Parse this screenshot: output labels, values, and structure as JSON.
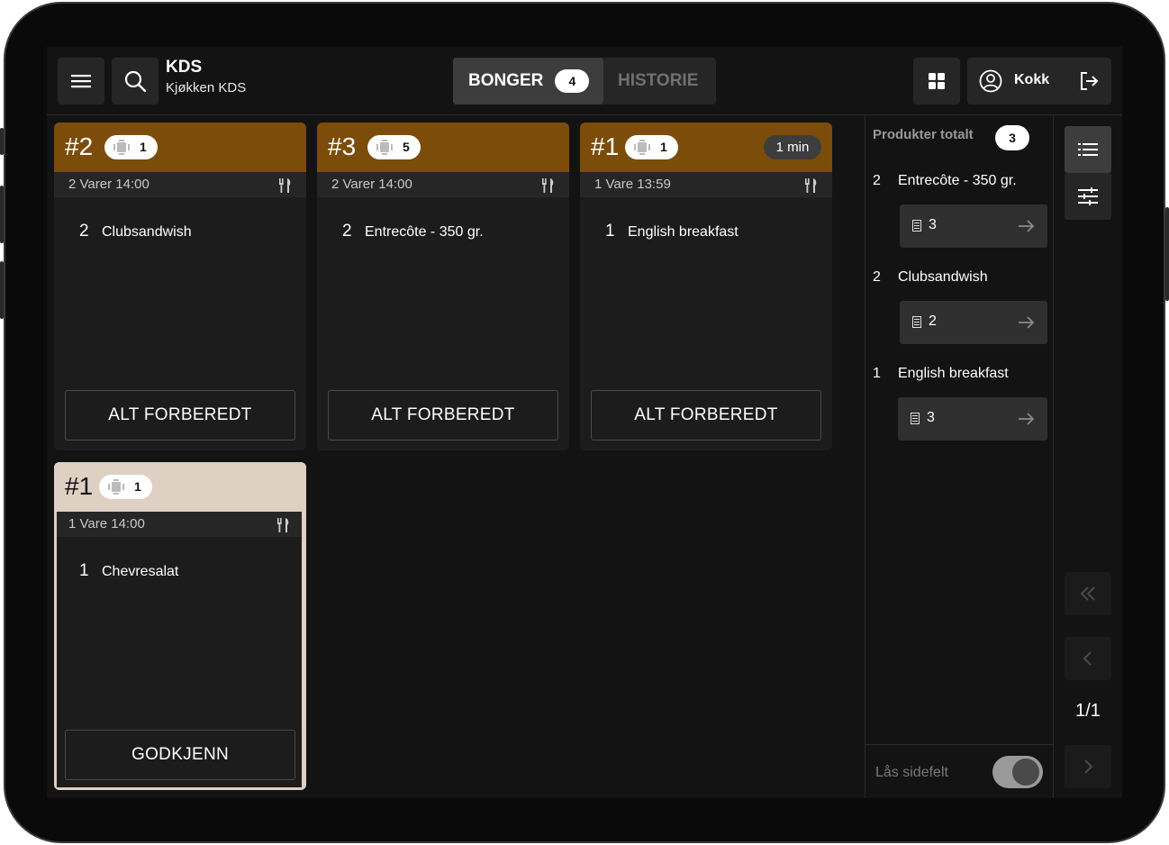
{
  "app": {
    "title": "KDS",
    "subtitle": "Kjøkken KDS"
  },
  "toolbar": {
    "menu_icon": "menu-icon",
    "search_icon": "search-icon",
    "grid_icon": "grid-icon",
    "user_icon": "user-circle-icon",
    "logout_icon": "logout-icon"
  },
  "tabs": [
    {
      "label": "BONGER",
      "count": "4",
      "active": true
    },
    {
      "label": "HISTORIE",
      "active": false
    }
  ],
  "user": {
    "name": "Kokk"
  },
  "orders": [
    {
      "number": "#2",
      "guests": "1",
      "info": "2 Varer  14:00",
      "items": [
        {
          "qty": "2",
          "name": "Clubsandwish"
        }
      ],
      "action": "ALT FORBEREDT"
    },
    {
      "number": "#3",
      "guests": "5",
      "info": "2 Varer  14:00",
      "items": [
        {
          "qty": "2",
          "name": "Entrecôte - 350 gr."
        }
      ],
      "action": "ALT FORBEREDT"
    },
    {
      "number": "#1",
      "guests": "1",
      "timer": "1 min",
      "info": "1 Vare  13:59",
      "items": [
        {
          "qty": "1",
          "name": "English breakfast"
        }
      ],
      "action": "ALT FORBEREDT"
    },
    {
      "number": "#1",
      "guests": "1",
      "info": "1 Vare  14:00",
      "items": [
        {
          "qty": "1",
          "name": "Chevresalat"
        }
      ],
      "action": "GODKJENN"
    }
  ],
  "products_panel": {
    "title": "Produkter totalt",
    "count": "3",
    "items": [
      {
        "qty": "2",
        "name": "Entrecôte - 350 gr.",
        "orders": "3"
      },
      {
        "qty": "2",
        "name": "Clubsandwish",
        "orders": "2"
      },
      {
        "qty": "1",
        "name": "English breakfast",
        "orders": "3"
      }
    ],
    "lock_label": "Lås sidefelt",
    "lock_on": true
  },
  "pager": {
    "text": "1/1"
  },
  "colors": {
    "header_active": "#7c4c0b",
    "header_approve": "#ded0c3",
    "background": "#131313"
  }
}
